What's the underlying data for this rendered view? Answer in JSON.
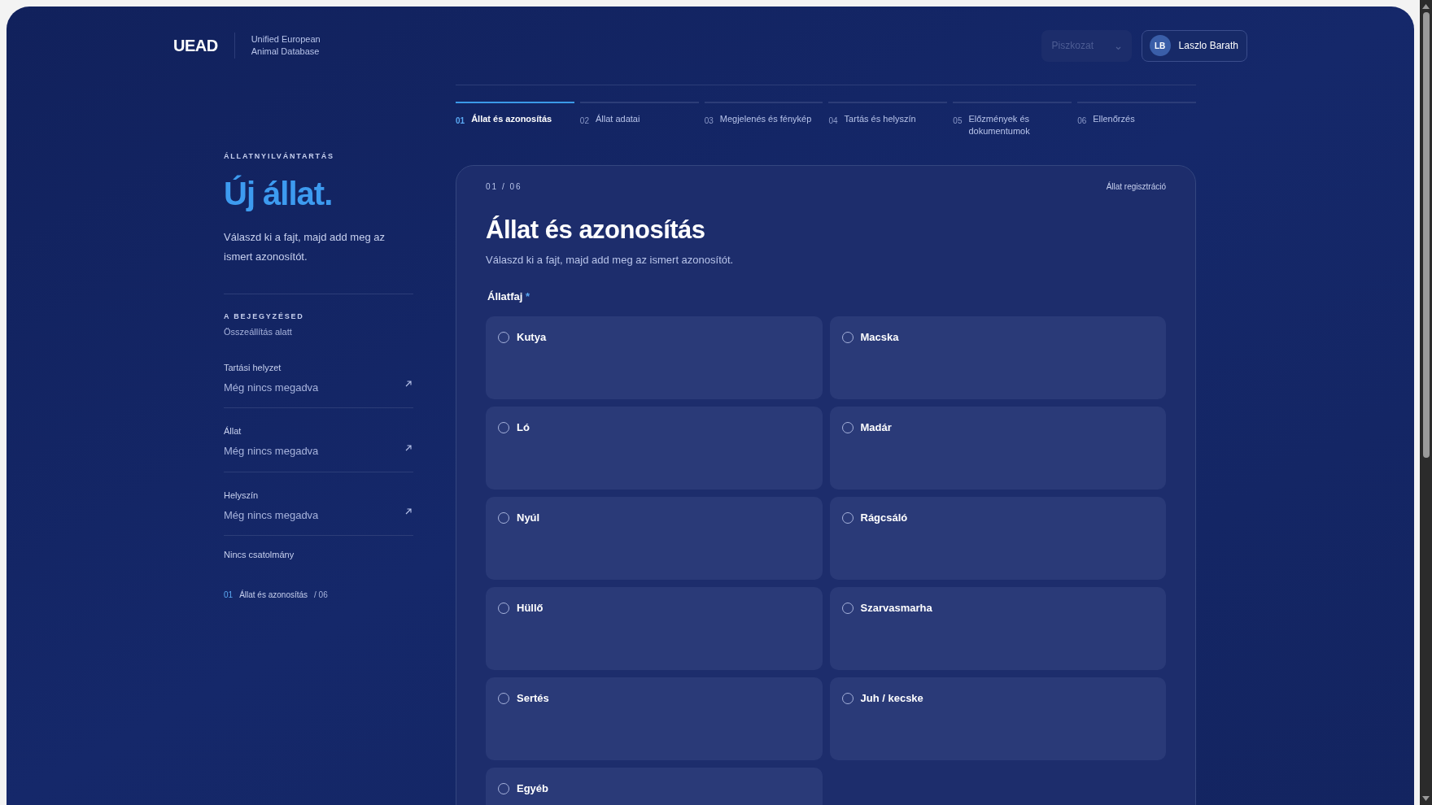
{
  "brand": {
    "logo": "UEAD",
    "subtitle_lines": [
      "Unified European",
      "Animal Database"
    ]
  },
  "header": {
    "draft_select": {
      "value": "Piszkozat",
      "disabled": true
    },
    "user": {
      "initials": "LB",
      "name": "Laszlo Barath"
    }
  },
  "steps": [
    {
      "number": "01",
      "label": "Állat és azonosítás",
      "selected": true
    },
    {
      "number": "02",
      "label": "Állat adatai",
      "selected": false
    },
    {
      "number": "03",
      "label": "Megjelenés és fénykép",
      "selected": false
    },
    {
      "number": "04",
      "label": "Tartás és helyszín",
      "selected": false
    },
    {
      "number": "05",
      "label": "Előzmények és dokumentumok",
      "selected": false
    },
    {
      "number": "06",
      "label": "Ellenőrzés",
      "selected": false
    }
  ],
  "sidebar": {
    "eyebrow": "ÁLLATNYILVÁNTARTÁS",
    "title": "Új állat.",
    "description": "Válaszd ki a fajt, majd add meg az ismert azonosítót.",
    "summary_heading": "A BEJEGYZÉSED",
    "summary_status": "Összeállítás alatt",
    "summary_items": [
      {
        "label": "Tartási helyzet",
        "value": "Még nincs megadva"
      },
      {
        "label": "Állat",
        "value": "Még nincs megadva"
      },
      {
        "label": "Helyszín",
        "value": "Még nincs megadva"
      }
    ],
    "attachments": "Nincs csatolmány",
    "progress": {
      "number": "01",
      "label": "Állat és azonosítás",
      "total": "/ 06"
    }
  },
  "card": {
    "counter": "01 / 06",
    "context": "Állat regisztráció",
    "title": "Állat és azonosítás",
    "description": "Válaszd ki a fajt, majd add meg az ismert azonosítót.",
    "field_label": "Állatfaj",
    "required_mark": "*",
    "options": [
      {
        "label": "Kutya",
        "selected": false
      },
      {
        "label": "Macska",
        "selected": false
      },
      {
        "label": "Ló",
        "selected": false
      },
      {
        "label": "Madár",
        "selected": false
      },
      {
        "label": "Nyúl",
        "selected": false
      },
      {
        "label": "Rágcsáló",
        "selected": false
      },
      {
        "label": "Hüllő",
        "selected": false
      },
      {
        "label": "Szarvasmarha",
        "selected": false
      },
      {
        "label": "Sertés",
        "selected": false
      },
      {
        "label": "Juh / kecske",
        "selected": false
      },
      {
        "label": "Egyéb",
        "selected": false
      }
    ]
  }
}
